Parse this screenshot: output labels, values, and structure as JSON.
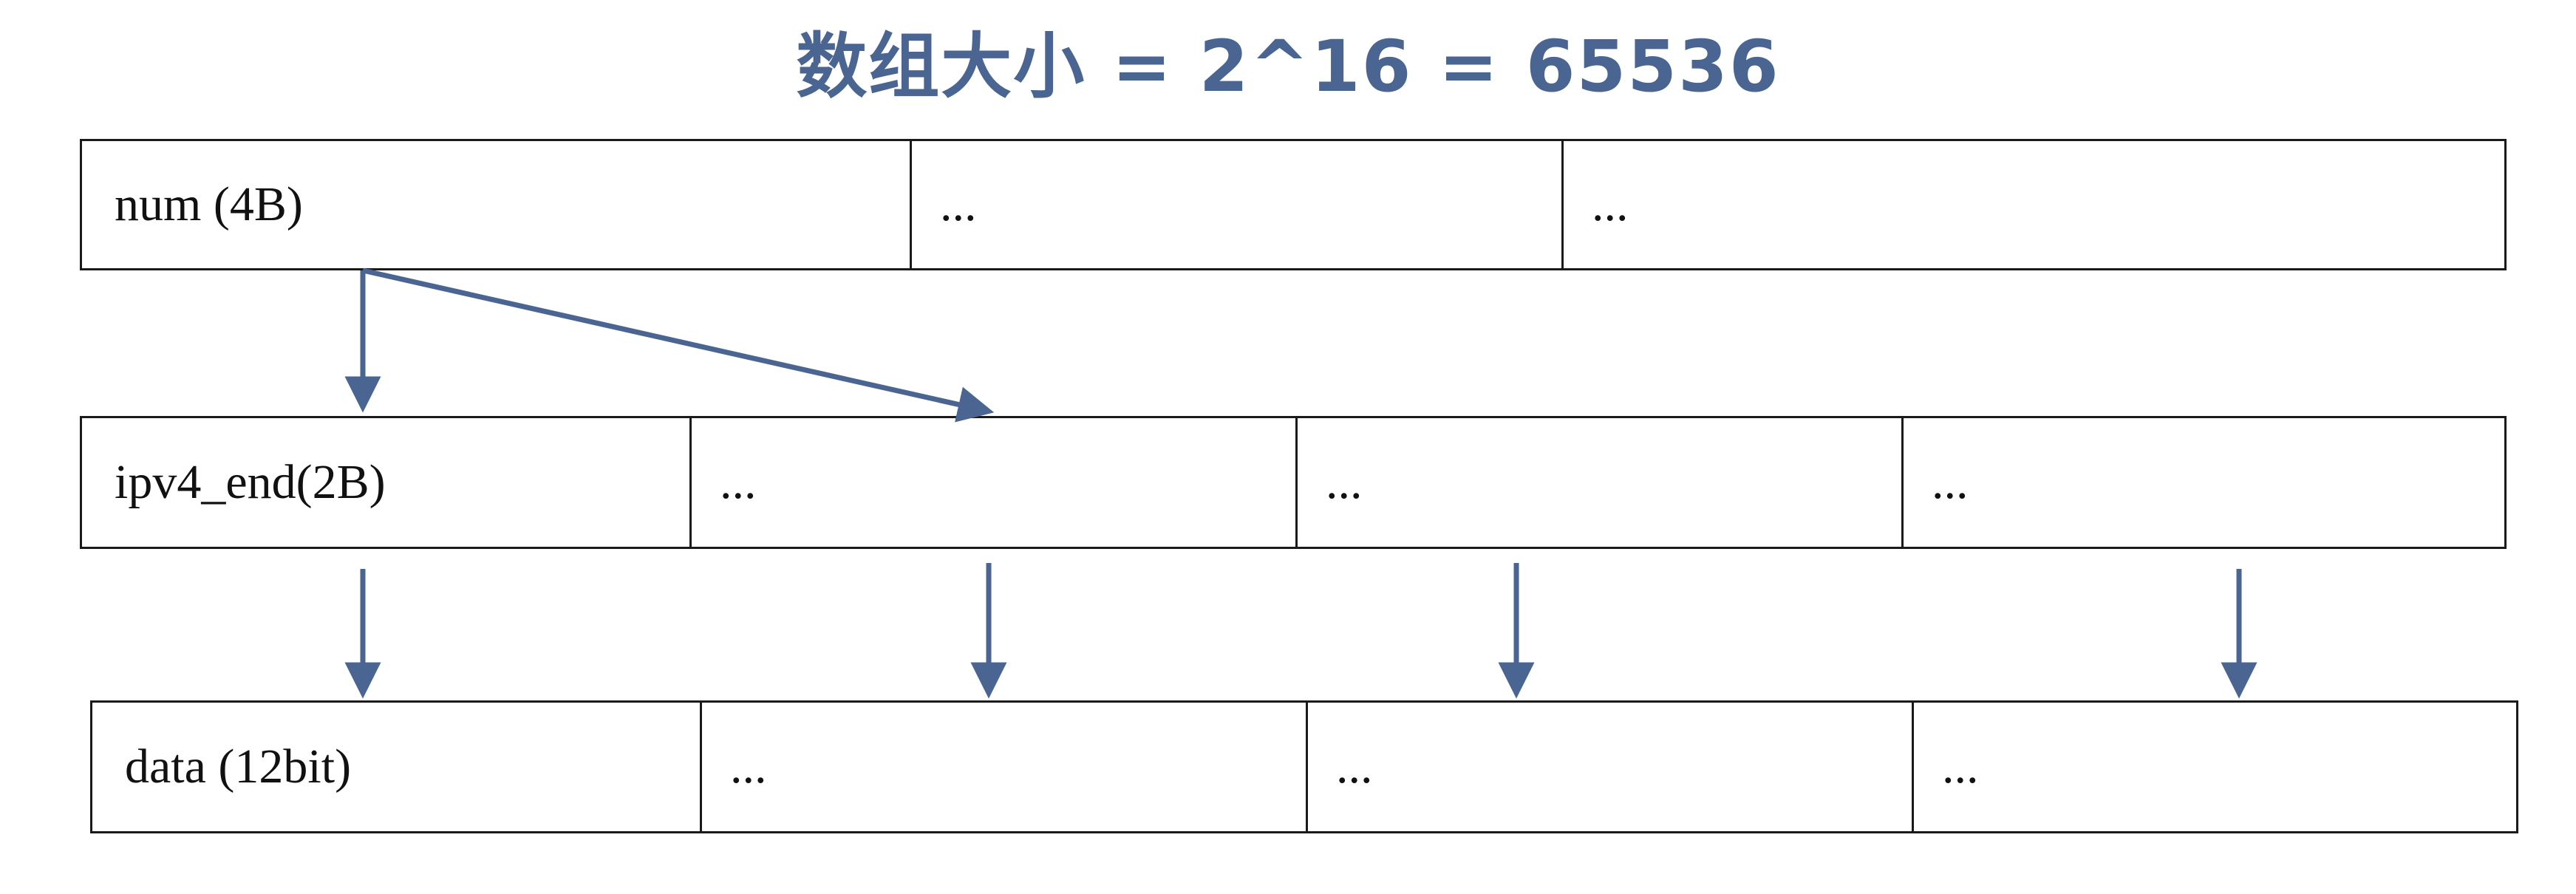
{
  "title": "数组大小 = 2^16 = 65536",
  "rows": [
    {
      "cells": [
        "num (4B)",
        "...",
        "..."
      ]
    },
    {
      "cells": [
        "ipv4_end(2B)",
        "...",
        "...",
        "..."
      ]
    },
    {
      "cells": [
        "data (12bit)",
        "...",
        "...",
        "..."
      ]
    }
  ],
  "colors": {
    "title": "#4a6591",
    "arrow": "#4a6591",
    "border": "#1a1a1a"
  }
}
